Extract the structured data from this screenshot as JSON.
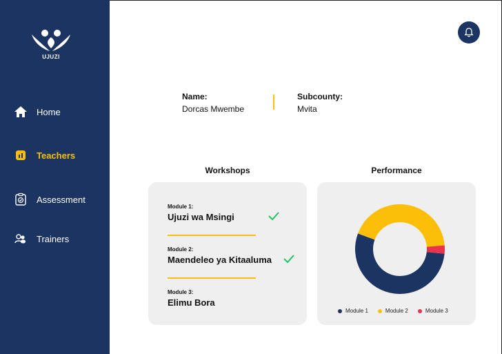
{
  "brand": {
    "logo_text": "UJUZI"
  },
  "sidebar": {
    "items": [
      {
        "label": "Home",
        "icon": "home-icon",
        "active": false
      },
      {
        "label": "Teachers",
        "icon": "teachers-icon",
        "active": true
      },
      {
        "label": "Assessment",
        "icon": "clipboard-icon",
        "active": false
      },
      {
        "label": "Trainers",
        "icon": "users-icon",
        "active": false
      }
    ]
  },
  "header": {
    "notification_icon": "bell-icon"
  },
  "profile": {
    "name_label": "Name:",
    "name_value": "Dorcas Mwembe",
    "subcounty_label": "Subcounty:",
    "subcounty_value": "Mvita"
  },
  "workshops": {
    "title": "Workshops",
    "modules": [
      {
        "kicker": "Module 1:",
        "title": "Ujuzi wa Msingi",
        "completed": true
      },
      {
        "kicker": "Module 2:",
        "title": "Maendeleo ya Kitaaluma",
        "completed": true
      },
      {
        "kicker": "Module 3:",
        "title": "Elimu Bora",
        "completed": false
      }
    ]
  },
  "performance": {
    "title": "Performance"
  },
  "colors": {
    "primary": "#1c3461",
    "accent": "#fbbf0a",
    "danger": "#e8334a",
    "check": "#22c55e"
  },
  "chart_data": {
    "type": "pie",
    "categories": [
      "Module 1",
      "Module 2",
      "Module 3"
    ],
    "values": [
      54,
      43,
      3
    ],
    "colors": [
      "#1c3461",
      "#fbbf0a",
      "#e8334a"
    ],
    "legend": "bottom"
  }
}
